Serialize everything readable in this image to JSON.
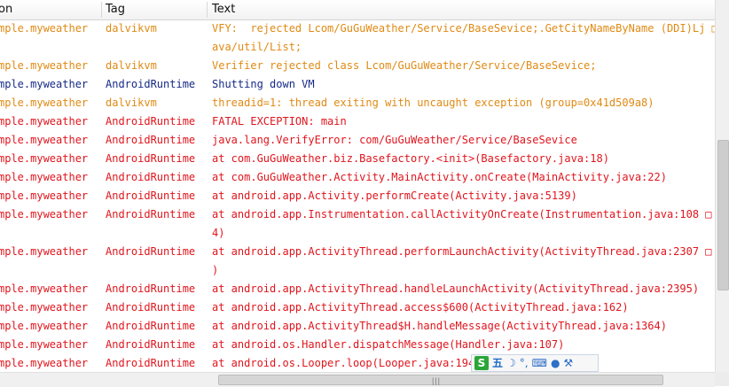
{
  "header": {
    "application": "on",
    "tag": "Tag",
    "text": "Text"
  },
  "rows": [
    {
      "level": "W",
      "app": "mple.myweather",
      "tag": "dalvikvm",
      "lines": [
        "VFY:  rejected Lcom/GuGuWeather/Service/BaseSevice;.GetCityNameByName (DDI)Lj □",
        "ava/util/List;"
      ]
    },
    {
      "level": "W",
      "app": "mple.myweather",
      "tag": "dalvikvm",
      "lines": [
        "Verifier rejected class Lcom/GuGuWeather/Service/BaseSevice;"
      ]
    },
    {
      "level": "I",
      "app": "mple.myweather",
      "tag": "AndroidRuntime",
      "lines": [
        "Shutting down VM"
      ]
    },
    {
      "level": "W",
      "app": "mple.myweather",
      "tag": "dalvikvm",
      "lines": [
        "threadid=1: thread exiting with uncaught exception (group=0x41d509a8)"
      ]
    },
    {
      "level": "E",
      "app": "mple.myweather",
      "tag": "AndroidRuntime",
      "lines": [
        "FATAL EXCEPTION: main"
      ]
    },
    {
      "level": "E",
      "app": "mple.myweather",
      "tag": "AndroidRuntime",
      "lines": [
        "java.lang.VerifyError: com/GuGuWeather/Service/BaseSevice"
      ]
    },
    {
      "level": "E",
      "app": "mple.myweather",
      "tag": "AndroidRuntime",
      "lines": [
        "at com.GuGuWeather.biz.Basefactory.<init>(Basefactory.java:18)"
      ]
    },
    {
      "level": "E",
      "app": "mple.myweather",
      "tag": "AndroidRuntime",
      "lines": [
        "at com.GuGuWeather.Activity.MainActivity.onCreate(MainActivity.java:22)"
      ]
    },
    {
      "level": "E",
      "app": "mple.myweather",
      "tag": "AndroidRuntime",
      "lines": [
        "at android.app.Activity.performCreate(Activity.java:5139)"
      ]
    },
    {
      "level": "E",
      "app": "mple.myweather",
      "tag": "AndroidRuntime",
      "lines": [
        "at android.app.Instrumentation.callActivityOnCreate(Instrumentation.java:108 □",
        "4)"
      ]
    },
    {
      "level": "E",
      "app": "mple.myweather",
      "tag": "AndroidRuntime",
      "lines": [
        "at android.app.ActivityThread.performLaunchActivity(ActivityThread.java:2307 □",
        ")"
      ]
    },
    {
      "level": "E",
      "app": "mple.myweather",
      "tag": "AndroidRuntime",
      "lines": [
        "at android.app.ActivityThread.handleLaunchActivity(ActivityThread.java:2395)"
      ]
    },
    {
      "level": "E",
      "app": "mple.myweather",
      "tag": "AndroidRuntime",
      "lines": [
        "at android.app.ActivityThread.access$600(ActivityThread.java:162)"
      ]
    },
    {
      "level": "E",
      "app": "mple.myweather",
      "tag": "AndroidRuntime",
      "lines": [
        "at android.app.ActivityThread$H.handleMessage(ActivityThread.java:1364)"
      ]
    },
    {
      "level": "E",
      "app": "mple.myweather",
      "tag": "AndroidRuntime",
      "lines": [
        "at android.os.Handler.dispatchMessage(Handler.java:107)"
      ]
    },
    {
      "level": "E",
      "app": "mple.myweather",
      "tag": "AndroidRuntime",
      "lines": [
        "at android.os.Looper.loop(Looper.java:194)"
      ]
    }
  ],
  "colors": {
    "warn": "#e08a14",
    "info": "#152a86",
    "error": "#e0151d"
  },
  "ime_toolbar": {
    "logo": "S",
    "wubi": "五",
    "moon": "☽",
    "punct": "°,",
    "keyboard": "⌨",
    "user": "●",
    "tool": "⚒"
  },
  "hscroll_grip": "|||"
}
